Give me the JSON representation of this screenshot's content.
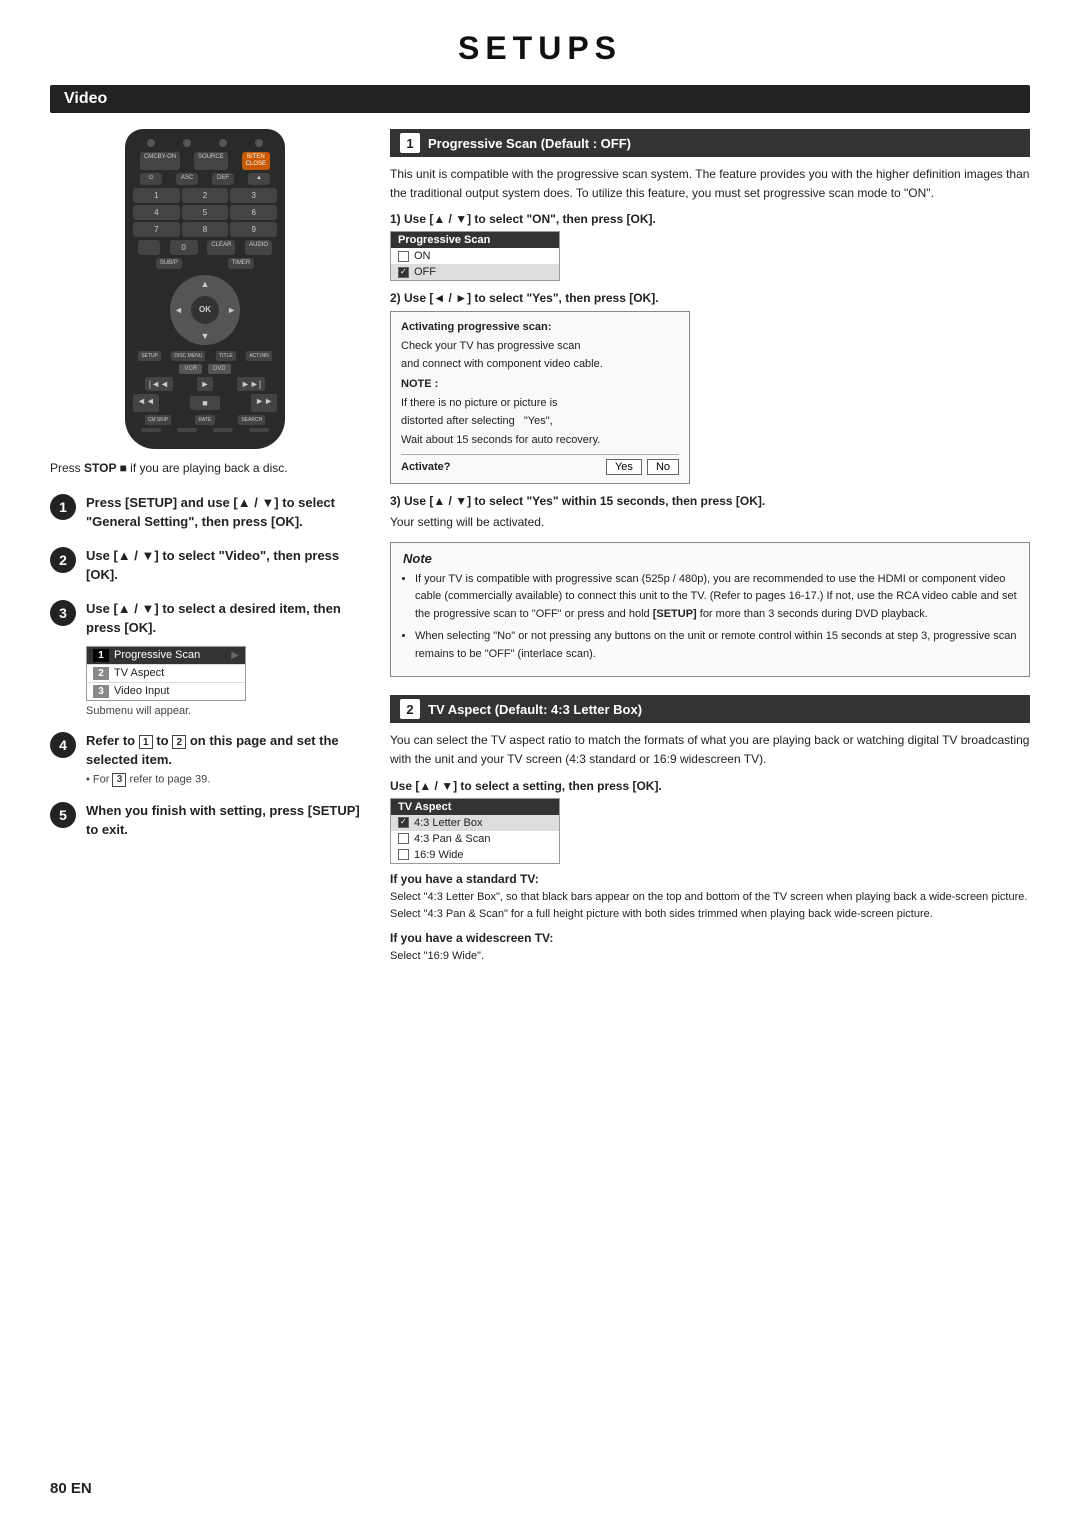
{
  "page": {
    "title": "SETUPS",
    "section": "Video",
    "page_number": "80  EN"
  },
  "press_stop_note": "Press STOP ■ if you are playing back a disc.",
  "left_steps": [
    {
      "num": "1",
      "text": "Press [SETUP] and use [▲ / ▼] to select \"General Setting\", then press [OK]."
    },
    {
      "num": "2",
      "text": "Use [▲ / ▼] to select \"Video\", then press [OK]."
    },
    {
      "num": "3",
      "text": "Use [▲ / ▼] to select a desired item, then press [OK]."
    }
  ],
  "submenu": {
    "items": [
      {
        "num": "1",
        "label": "Progressive Scan",
        "active": true,
        "arrow": "▶"
      },
      {
        "num": "2",
        "label": "TV Aspect",
        "active": false
      },
      {
        "num": "3",
        "label": "Video Input",
        "active": false
      }
    ],
    "note": "Submenu will appear."
  },
  "step4": {
    "num": "4",
    "text1": "Refer to",
    "text2": "to",
    "text3": "on this page and set the selected item.",
    "note": "• For  3  refer to page 39."
  },
  "step5": {
    "num": "5",
    "text": "When you finish with setting, press [SETUP] to exit."
  },
  "right": {
    "section1": {
      "badge": "1",
      "title": "Progressive Scan (Default : OFF)",
      "description": "This unit is compatible with the progressive scan system. The feature provides you with the higher definition images than the traditional output system does. To utilize this feature, you must set progressive scan mode to \"ON\".",
      "sub1": {
        "label": "1) Use [▲ / ▼] to select \"ON\", then press [OK].",
        "box_header": "Progressive Scan",
        "options": [
          {
            "label": "ON",
            "checked": false
          },
          {
            "label": "OFF",
            "checked": true
          }
        ]
      },
      "sub2": {
        "label": "2) Use [◄ / ►] to select \"Yes\", then press [OK].",
        "activate_lines": [
          "Activating progressive scan:",
          "Check your TV has progressive scan",
          "and connect with component video cable."
        ],
        "note_label": "NOTE :",
        "note_lines": [
          "If there is no picture or picture is",
          "distorted after selecting   \"Yes\",",
          "Wait about 15 seconds for auto recovery."
        ],
        "activate_label": "Activate?",
        "yes": "Yes",
        "no": "No"
      },
      "sub3": {
        "label": "3) Use [▲ / ▼] to select \"Yes\" within 15 seconds, then press [OK].",
        "note": "Your setting will be activated."
      },
      "note_box": {
        "title": "Note",
        "items": [
          "If your TV is compatible with progressive scan (525p / 480p), you are recommended to use the HDMI or component video cable (commercially available) to connect this unit to the TV. (Refer to pages 16-17.) If not, use the RCA video cable and set the progressive scan to \"OFF\" or press and hold [SETUP] for more than 3 seconds during DVD playback.",
          "When selecting \"No\" or not pressing any buttons on the unit or remote control within 15 seconds at step 3, progressive scan remains to be \"OFF\" (interlace scan)."
        ]
      }
    },
    "section2": {
      "badge": "2",
      "title": "TV Aspect (Default: 4:3 Letter Box)",
      "description": "You can select the TV aspect ratio to match the formats of what you are playing back or watching digital TV broadcasting with the unit and your TV screen (4:3 standard or 16:9 widescreen TV).",
      "sub1": {
        "label": "Use [▲ / ▼] to select a setting, then press [OK].",
        "box_header": "TV Aspect",
        "options": [
          {
            "label": "4:3 Letter Box",
            "checked": true
          },
          {
            "label": "4:3 Pan & Scan",
            "checked": false
          },
          {
            "label": "16:9 Wide",
            "checked": false
          }
        ]
      },
      "if_standard": {
        "heading": "If you have a standard TV:",
        "text": "Select \"4:3 Letter Box\", so that black bars appear on the top and bottom of the TV screen when playing back a wide-screen picture. Select \"4:3 Pan & Scan\" for a full height picture with both sides trimmed when playing back wide-screen picture."
      },
      "if_widescreen": {
        "heading": "If you have a widescreen TV:",
        "text": "Select \"16:9 Wide\"."
      }
    }
  }
}
